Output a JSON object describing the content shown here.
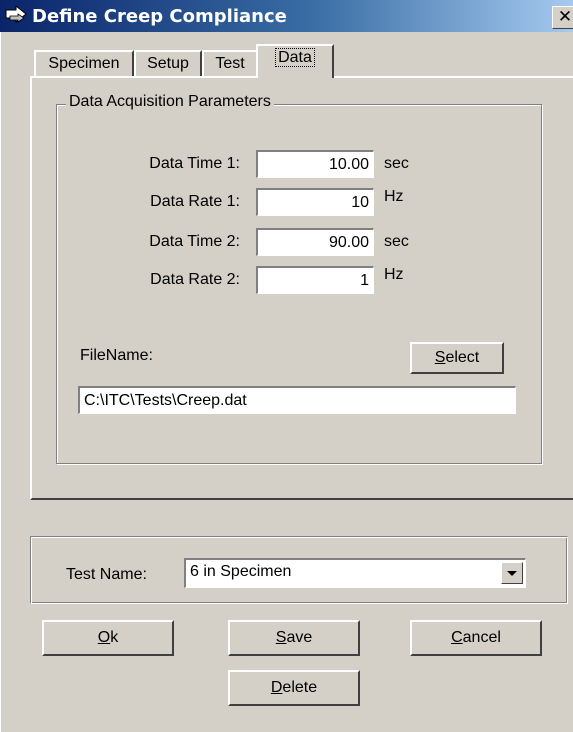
{
  "window": {
    "title": "Define Creep Compliance",
    "close_glyph": "✕"
  },
  "tabs": [
    {
      "label": "Specimen"
    },
    {
      "label": "Setup"
    },
    {
      "label": "Test"
    },
    {
      "label": "Data"
    }
  ],
  "group": {
    "title": "Data Acquisition Parameters",
    "params": [
      {
        "label": "Data Time 1:",
        "value": "10.00",
        "unit": "sec"
      },
      {
        "label": "Data Rate 1:",
        "value": "10",
        "unit": "Hz"
      },
      {
        "label": "Data Time 2:",
        "value": "90.00",
        "unit": "sec"
      },
      {
        "label": "Data Rate 2:",
        "value": "1",
        "unit": "Hz"
      }
    ],
    "filename_label": "FileName:",
    "select_button": {
      "accel": "S",
      "rest": "elect"
    },
    "filename_value": "C:\\ITC\\Tests\\Creep.dat"
  },
  "test_name": {
    "label": "Test Name:",
    "value": "6 in Specimen"
  },
  "buttons": {
    "ok": {
      "accel": "O",
      "rest": "k"
    },
    "save": {
      "accel": "S",
      "rest": "ave"
    },
    "cancel": {
      "accel": "C",
      "rest": "ancel"
    },
    "delete": {
      "accel": "D",
      "rest": "elete"
    }
  },
  "colors": {
    "face": "#d4d0c8",
    "title_start": "#0a246a",
    "title_end": "#a6caf0"
  },
  "icons": {
    "app": "arrow-app-icon",
    "close": "close-icon",
    "dropdown": "chevron-down-icon"
  }
}
